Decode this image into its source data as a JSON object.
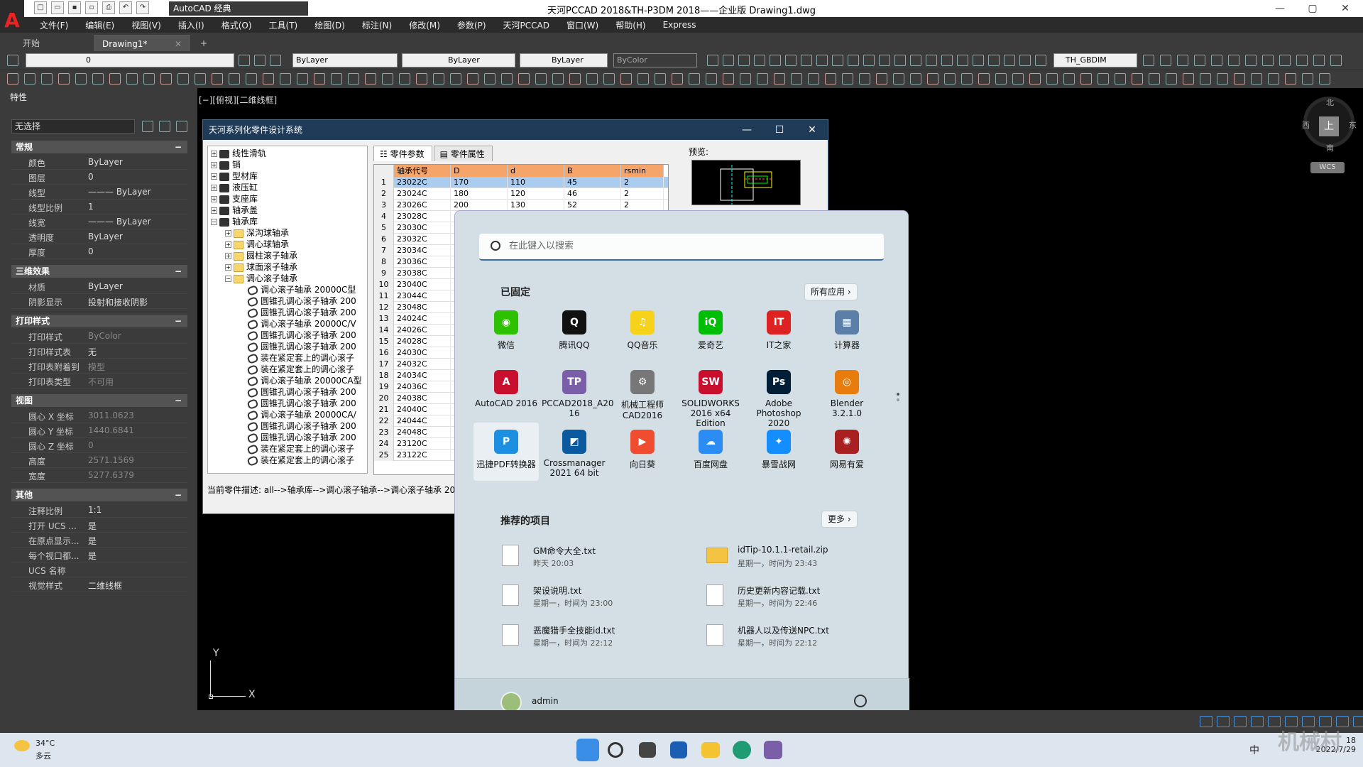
{
  "window": {
    "title": "天河PCCAD 2018&TH-P3DM 2018——企业版    Drawing1.dwg",
    "workspace": "AutoCAD 经典",
    "min": "—",
    "max": "▢",
    "close": "✕"
  },
  "menu": [
    "文件(F)",
    "编辑(E)",
    "视图(V)",
    "插入(I)",
    "格式(O)",
    "工具(T)",
    "绘图(D)",
    "标注(N)",
    "修改(M)",
    "参数(P)",
    "天河PCCAD",
    "窗口(W)",
    "帮助(H)",
    "Express"
  ],
  "tabs": {
    "start": "开始",
    "drawing": "Drawing1*",
    "close": "✕",
    "add": "+"
  },
  "toolbar": {
    "layer": "0",
    "color": "ByLayer",
    "linetype": "ByLayer",
    "lineweight": "ByLayer",
    "plotstyle": "ByColor",
    "dimstyle": "TH_GBDIM"
  },
  "props": {
    "title": "特性",
    "selection": "无选择",
    "sections": {
      "general": "常规",
      "3d": "三维效果",
      "plot": "打印样式",
      "view": "视图",
      "misc": "其他"
    },
    "general": [
      [
        "颜色",
        "ByLayer"
      ],
      [
        "图层",
        "0"
      ],
      [
        "线型",
        "——— ByLayer"
      ],
      [
        "线型比例",
        "1"
      ],
      [
        "线宽",
        "——— ByLayer"
      ],
      [
        "透明度",
        "ByLayer"
      ],
      [
        "厚度",
        "0"
      ]
    ],
    "threed": [
      [
        "材质",
        "ByLayer"
      ],
      [
        "阴影显示",
        "投射和接收阴影"
      ]
    ],
    "plot": [
      [
        "打印样式",
        "ByColor"
      ],
      [
        "打印样式表",
        "无"
      ],
      [
        "打印表附着到",
        "模型"
      ],
      [
        "打印表类型",
        "不可用"
      ]
    ],
    "view": [
      [
        "圆心 X 坐标",
        "3011.0623"
      ],
      [
        "圆心 Y 坐标",
        "1440.6841"
      ],
      [
        "圆心 Z 坐标",
        "0"
      ],
      [
        "高度",
        "2571.1569"
      ],
      [
        "宽度",
        "5277.6379"
      ]
    ],
    "misc": [
      [
        "注释比例",
        "1:1"
      ],
      [
        "打开 UCS ...",
        "是"
      ],
      [
        "在原点显示...",
        "是"
      ],
      [
        "每个视口都...",
        "是"
      ],
      [
        "UCS 名称",
        ""
      ],
      [
        "视觉样式",
        "二维线框"
      ]
    ]
  },
  "viewport": {
    "label": "[−][俯视][二维线框]",
    "north": "北",
    "south": "南",
    "east": "东",
    "west": "西",
    "top": "上",
    "wcs": "WCS",
    "y": "Y",
    "x": "X"
  },
  "th": {
    "title": "天河系列化零件设计系统",
    "min": "—",
    "max": "☐",
    "close": "✕",
    "tree": [
      {
        "t": "线性滑轨",
        "l": 0,
        "k": "bk",
        "b": "+"
      },
      {
        "t": "销",
        "l": 0,
        "k": "bk",
        "b": "+"
      },
      {
        "t": "型材库",
        "l": 0,
        "k": "bk",
        "b": "+"
      },
      {
        "t": "液压缸",
        "l": 0,
        "k": "bk",
        "b": "+"
      },
      {
        "t": "支座库",
        "l": 0,
        "k": "bk",
        "b": "+"
      },
      {
        "t": "轴承盖",
        "l": 0,
        "k": "bk",
        "b": "+"
      },
      {
        "t": "轴承库",
        "l": 0,
        "k": "bk",
        "b": "−"
      },
      {
        "t": "深沟球轴承",
        "l": 1,
        "k": "fd",
        "b": "+"
      },
      {
        "t": "调心球轴承",
        "l": 1,
        "k": "fd",
        "b": "+"
      },
      {
        "t": "圆柱滚子轴承",
        "l": 1,
        "k": "fd",
        "b": "+"
      },
      {
        "t": "球面滚子轴承",
        "l": 1,
        "k": "fd",
        "b": "+"
      },
      {
        "t": "调心滚子轴承",
        "l": 1,
        "k": "fd",
        "b": "−"
      },
      {
        "t": "调心滚子轴承 20000C型",
        "l": 2,
        "k": "pt",
        "b": ""
      },
      {
        "t": "圆锥孔调心滚子轴承 200",
        "l": 2,
        "k": "pt",
        "b": ""
      },
      {
        "t": "圆锥孔调心滚子轴承 200",
        "l": 2,
        "k": "pt",
        "b": ""
      },
      {
        "t": "调心滚子轴承 20000C/V",
        "l": 2,
        "k": "pt",
        "b": ""
      },
      {
        "t": "圆锥孔调心滚子轴承 200",
        "l": 2,
        "k": "pt",
        "b": ""
      },
      {
        "t": "圆锥孔调心滚子轴承 200",
        "l": 2,
        "k": "pt",
        "b": ""
      },
      {
        "t": "装在紧定套上的调心滚子",
        "l": 2,
        "k": "pt",
        "b": ""
      },
      {
        "t": "装在紧定套上的调心滚子",
        "l": 2,
        "k": "pt",
        "b": ""
      },
      {
        "t": "调心滚子轴承 20000CA型",
        "l": 2,
        "k": "pt",
        "b": ""
      },
      {
        "t": "圆锥孔调心滚子轴承 200",
        "l": 2,
        "k": "pt",
        "b": ""
      },
      {
        "t": "圆锥孔调心滚子轴承 200",
        "l": 2,
        "k": "pt",
        "b": ""
      },
      {
        "t": "调心滚子轴承 20000CA/",
        "l": 2,
        "k": "pt",
        "b": ""
      },
      {
        "t": "圆锥孔调心滚子轴承 200",
        "l": 2,
        "k": "pt",
        "b": ""
      },
      {
        "t": "圆锥孔调心滚子轴承 200",
        "l": 2,
        "k": "pt",
        "b": ""
      },
      {
        "t": "装在紧定套上的调心滚子",
        "l": 2,
        "k": "pt",
        "b": ""
      },
      {
        "t": "装在紧定套上的调心滚子",
        "l": 2,
        "k": "pt",
        "b": ""
      }
    ],
    "tab_params": "零件参数",
    "tab_attrs": "零件属性",
    "columns": [
      "轴承代号",
      "D",
      "d",
      "B",
      "rsmin"
    ],
    "rows": [
      [
        "23022C",
        "170",
        "110",
        "45",
        "2"
      ],
      [
        "23024C",
        "180",
        "120",
        "46",
        "2"
      ],
      [
        "23026C",
        "200",
        "130",
        "52",
        "2"
      ],
      [
        "23028C"
      ],
      [
        "23030C"
      ],
      [
        "23032C"
      ],
      [
        "23034C"
      ],
      [
        "23036C"
      ],
      [
        "23038C"
      ],
      [
        "23040C"
      ],
      [
        "23044C"
      ],
      [
        "23048C"
      ],
      [
        "24024C"
      ],
      [
        "24026C"
      ],
      [
        "24028C"
      ],
      [
        "24030C"
      ],
      [
        "24032C"
      ],
      [
        "24034C"
      ],
      [
        "24036C"
      ],
      [
        "24038C"
      ],
      [
        "24040C"
      ],
      [
        "24044C"
      ],
      [
        "24048C"
      ],
      [
        "23120C"
      ],
      [
        "23122C"
      ]
    ],
    "preview": "预览:",
    "desc": "当前零件描述: all-->轴承库-->调心滚子轴承-->调心滚子轴承 20"
  },
  "start": {
    "search": "在此键入以搜索",
    "pinned": "已固定",
    "allapps": "所有应用  ›",
    "apps": [
      {
        "n": "微信",
        "c": "#2dc100",
        "g": "◉"
      },
      {
        "n": "腾讯QQ",
        "c": "#111",
        "g": "Q"
      },
      {
        "n": "QQ音乐",
        "c": "#f7d21b",
        "g": "♫"
      },
      {
        "n": "爱奇艺",
        "c": "#00be06",
        "g": "iQ"
      },
      {
        "n": "IT之家",
        "c": "#d22",
        "g": "IT"
      },
      {
        "n": "计算器",
        "c": "#5b7fa8",
        "g": "▦"
      },
      {
        "n": "AutoCAD 2016",
        "c": "#c8102e",
        "g": "A"
      },
      {
        "n": "PCCAD2018_A20 16",
        "c": "#7a5fa8",
        "g": "TP"
      },
      {
        "n": "机械工程师 CAD2016",
        "c": "#777",
        "g": "⚙"
      },
      {
        "n": "SOLIDWORKS 2016 x64 Edition",
        "c": "#c8102e",
        "g": "SW"
      },
      {
        "n": "Adobe Photoshop 2020",
        "c": "#001e36",
        "g": "Ps"
      },
      {
        "n": "Blender 3.2.1.0",
        "c": "#e87d0d",
        "g": "◎"
      },
      {
        "n": "迅捷PDF转换器",
        "c": "#1c8fe0",
        "g": "P"
      },
      {
        "n": "Crossmanager 2021 64 bit",
        "c": "#0b5aa0",
        "g": "◩"
      },
      {
        "n": "向日葵",
        "c": "#f04d30",
        "g": "▶"
      },
      {
        "n": "百度网盘",
        "c": "#2b8cf4",
        "g": "☁"
      },
      {
        "n": "暴雪战网",
        "c": "#148eff",
        "g": "✦"
      },
      {
        "n": "网易有爱",
        "c": "#a82020",
        "g": "✺"
      }
    ],
    "recommended": "推荐的项目",
    "more": "更多  ›",
    "recent": [
      {
        "n": "GM命令大全.txt",
        "t": "昨天 20:03",
        "z": false
      },
      {
        "n": "idTip-10.1.1-retail.zip",
        "t": "星期一，时间为 23:43",
        "z": true
      },
      {
        "n": "架设说明.txt",
        "t": "星期一，时间为 23:00",
        "z": false
      },
      {
        "n": "历史更新内容记载.txt",
        "t": "星期一，时间为 22:46",
        "z": false
      },
      {
        "n": "恶魔猎手全技能id.txt",
        "t": "星期一，时间为 22:12",
        "z": false
      },
      {
        "n": "机器人以及传送NPC.txt",
        "t": "星期一，时间为 22:12",
        "z": false
      }
    ],
    "user": "admin"
  },
  "taskbar": {
    "temp": "34°C",
    "weather": "多云",
    "time": "18",
    "date": "2022/7/29",
    "ime": "中",
    "watermark": "机械村"
  }
}
